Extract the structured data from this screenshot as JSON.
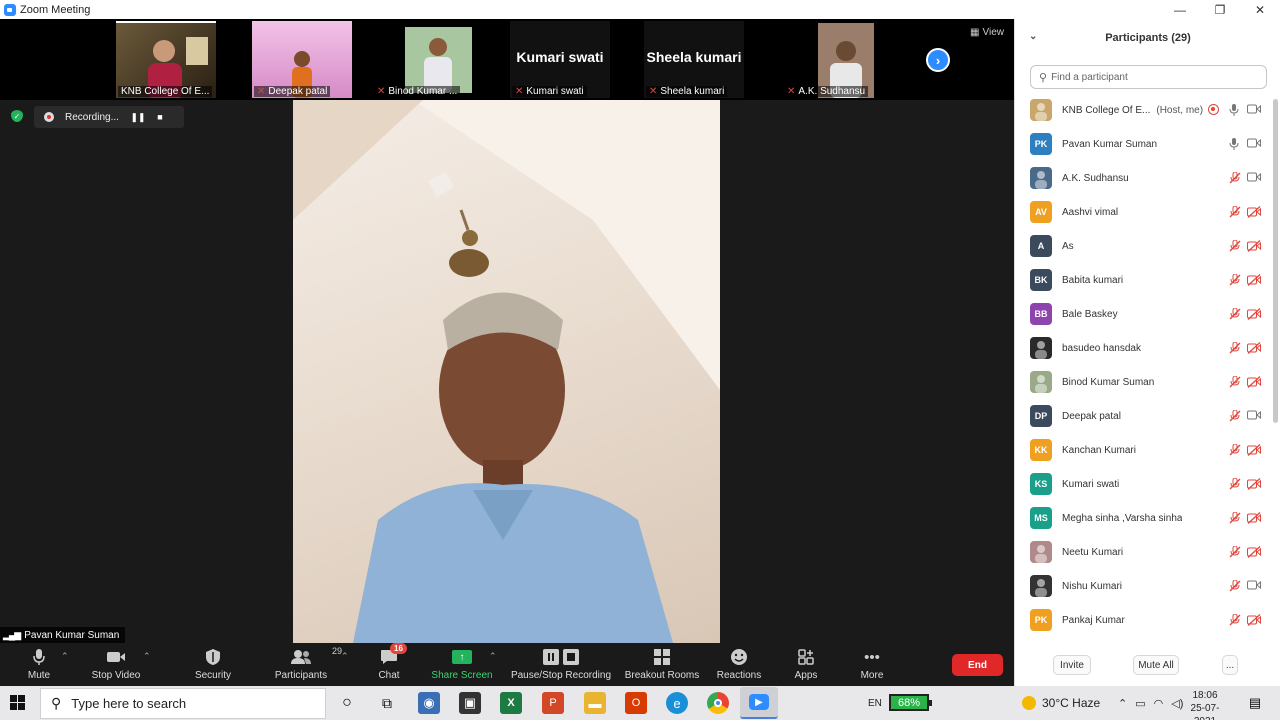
{
  "window": {
    "title": "Zoom Meeting",
    "controls": {
      "minimize": "—",
      "maximize": "❐",
      "close": "✕"
    }
  },
  "strip": {
    "view_label": "View",
    "tiles": [
      {
        "name": "KNB College Of E...",
        "muted": false,
        "type": "photo",
        "color": "#4a3a2a"
      },
      {
        "name": "Deepak patal",
        "muted": true,
        "type": "photo",
        "color": "#e9a4d8"
      },
      {
        "name": "Binod Kumar ...",
        "muted": true,
        "type": "photo",
        "color": "#c9d8e2"
      },
      {
        "name": "Kumari swati",
        "muted": true,
        "type": "text",
        "big": "Kumari swati"
      },
      {
        "name": "Sheela kumari",
        "muted": true,
        "type": "text",
        "big": "Sheela kumari"
      },
      {
        "name": "A.K. Sudhansu",
        "muted": true,
        "type": "photo",
        "color": "#8a7060"
      }
    ]
  },
  "recording": {
    "label": "Recording...",
    "pause_icon": "❚❚",
    "stop_icon": "■"
  },
  "speaker": {
    "name": "Pavan Kumar Suman",
    "signal_icon": "▂▄▆"
  },
  "toolbar": {
    "mute": "Mute",
    "stop_video": "Stop Video",
    "security": "Security",
    "participants": "Participants",
    "participants_count": "29",
    "chat": "Chat",
    "chat_badge": "16",
    "share_screen": "Share Screen",
    "pause_stop_recording": "Pause/Stop Recording",
    "breakout_rooms": "Breakout Rooms",
    "reactions": "Reactions",
    "apps": "Apps",
    "more": "More",
    "end": "End"
  },
  "panel": {
    "title": "Participants (29)",
    "search_placeholder": "Find a participant",
    "participants": [
      {
        "name": "KNB College Of E...",
        "tag": "(Host, me)",
        "initials": "",
        "color": "#c9a66b",
        "photo": true,
        "mic": "on",
        "cam": "on",
        "recording": true
      },
      {
        "name": "Pavan Kumar Suman",
        "tag": "",
        "initials": "PK",
        "color": "#2e7fbf",
        "photo": false,
        "mic": "on",
        "cam": "on"
      },
      {
        "name": "A.K. Sudhansu",
        "tag": "",
        "initials": "",
        "color": "#4a6a8a",
        "photo": true,
        "mic": "off",
        "cam": "on"
      },
      {
        "name": "Aashvi vimal",
        "tag": "",
        "initials": "AV",
        "color": "#f0a020",
        "photo": false,
        "mic": "off",
        "cam": "off"
      },
      {
        "name": "As",
        "tag": "",
        "initials": "A",
        "color": "#3b4a5c",
        "photo": false,
        "mic": "off",
        "cam": "off"
      },
      {
        "name": "Babita kumari",
        "tag": "",
        "initials": "BK",
        "color": "#3b4a5c",
        "photo": false,
        "mic": "off",
        "cam": "off"
      },
      {
        "name": "Bale Baskey",
        "tag": "",
        "initials": "BB",
        "color": "#8e44ad",
        "photo": false,
        "mic": "off",
        "cam": "off"
      },
      {
        "name": "basudeo hansdak",
        "tag": "",
        "initials": "",
        "color": "#2a2a2a",
        "photo": true,
        "mic": "off",
        "cam": "off"
      },
      {
        "name": "Binod Kumar Suman",
        "tag": "",
        "initials": "",
        "color": "#9aaa88",
        "photo": true,
        "mic": "off",
        "cam": "off"
      },
      {
        "name": "Deepak patal",
        "tag": "",
        "initials": "DP",
        "color": "#3b4a5c",
        "photo": false,
        "mic": "off",
        "cam": "on"
      },
      {
        "name": "Kanchan Kumari",
        "tag": "",
        "initials": "KK",
        "color": "#f0a020",
        "photo": false,
        "mic": "off",
        "cam": "off"
      },
      {
        "name": "Kumari swati",
        "tag": "",
        "initials": "KS",
        "color": "#1aa08a",
        "photo": false,
        "mic": "off",
        "cam": "off"
      },
      {
        "name": "Megha sinha ,Varsha sinha",
        "tag": "",
        "initials": "MS",
        "color": "#1aa08a",
        "photo": false,
        "mic": "off",
        "cam": "off"
      },
      {
        "name": "Neetu Kumari",
        "tag": "",
        "initials": "",
        "color": "#b08a8a",
        "photo": true,
        "mic": "off",
        "cam": "off"
      },
      {
        "name": "Nishu Kumari",
        "tag": "",
        "initials": "",
        "color": "#333333",
        "photo": true,
        "mic": "off",
        "cam": "on"
      },
      {
        "name": "Pankaj Kumar",
        "tag": "",
        "initials": "PK",
        "color": "#f0a020",
        "photo": false,
        "mic": "off",
        "cam": "off"
      }
    ],
    "footer": {
      "invite": "Invite",
      "mute_all": "Mute All",
      "more": "..."
    }
  },
  "taskbar": {
    "search_placeholder": "Type here to search",
    "language": "EN",
    "battery": "68%",
    "weather": "30°C  Haze",
    "time": "18:06",
    "date": "25-07-2021"
  }
}
